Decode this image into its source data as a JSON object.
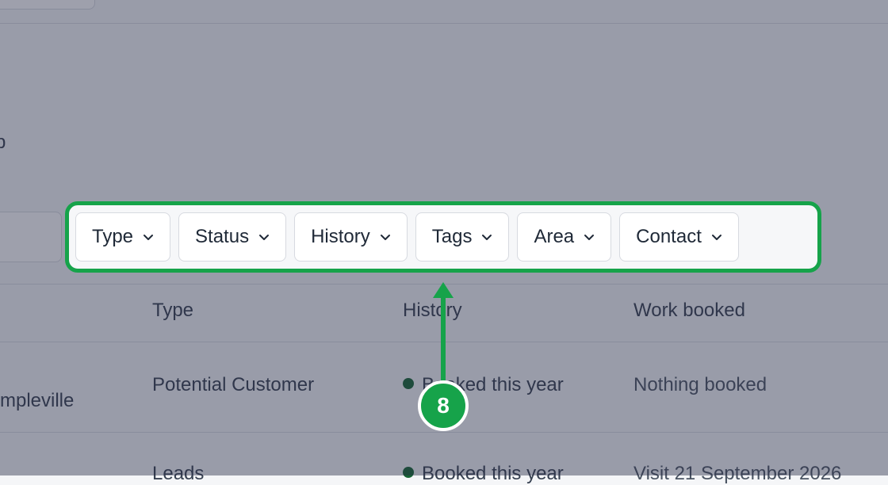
{
  "page": {
    "side_text": "p",
    "filters": [
      {
        "label": "Type"
      },
      {
        "label": "Status"
      },
      {
        "label": "History"
      },
      {
        "label": "Tags"
      },
      {
        "label": "Area"
      },
      {
        "label": "Contact"
      }
    ],
    "table": {
      "columns": [
        "Type",
        "History",
        "Work booked"
      ],
      "rows": [
        {
          "name_partial": "mpleville",
          "type": "Potential Customer",
          "history": "Booked this year",
          "work_booked": "Nothing booked"
        },
        {
          "type": "Leads",
          "history": "Booked this year",
          "work_booked": "Visit 21 September 2026"
        }
      ]
    }
  },
  "callout": {
    "step": "8",
    "color": "#16a34a"
  },
  "colors": {
    "history_dot": "#166534",
    "overlay": "#282d46"
  }
}
